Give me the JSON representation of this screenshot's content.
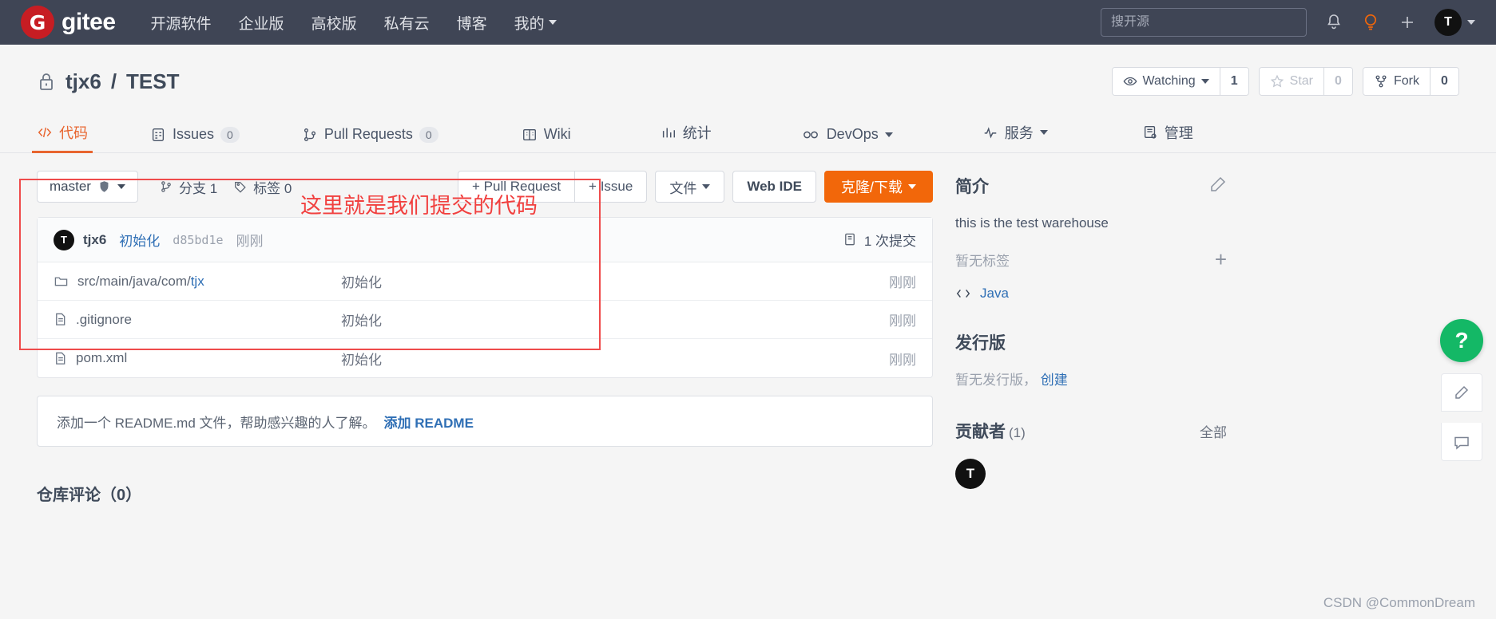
{
  "topnav": {
    "logo_letter": "G",
    "logo_text": "gitee",
    "links": [
      {
        "label": "开源软件",
        "caret": false
      },
      {
        "label": "企业版",
        "caret": false
      },
      {
        "label": "高校版",
        "caret": false
      },
      {
        "label": "私有云",
        "caret": false
      },
      {
        "label": "博客",
        "caret": false
      },
      {
        "label": "我的",
        "caret": true
      }
    ],
    "search_placeholder": "搜开源",
    "avatar_letter": "T",
    "accent_color": "#f2670a",
    "bar_color": "#3f4555"
  },
  "repo": {
    "owner": "tjx6",
    "separator": "/",
    "name": "TEST",
    "watch_label": "Watching",
    "watch_count": "1",
    "star_label": "Star",
    "star_count": "0",
    "fork_label": "Fork",
    "fork_count": "0"
  },
  "tabs": [
    {
      "label": "代码",
      "badge": "",
      "active": true,
      "caret": false
    },
    {
      "label": "Issues",
      "badge": "0",
      "active": false,
      "caret": false
    },
    {
      "label": "Pull Requests",
      "badge": "0",
      "active": false,
      "caret": false
    },
    {
      "label": "Wiki",
      "badge": "",
      "active": false,
      "caret": false
    },
    {
      "label": "统计",
      "badge": "",
      "active": false,
      "caret": false
    },
    {
      "label": "DevOps",
      "badge": "",
      "active": false,
      "caret": true
    },
    {
      "label": "服务",
      "badge": "",
      "active": false,
      "caret": true
    },
    {
      "label": "管理",
      "badge": "",
      "active": false,
      "caret": false
    }
  ],
  "toolbar": {
    "branch": "master",
    "branches_label": "分支 1",
    "tags_label": "标签 0",
    "pull_request_btn": "+ Pull Request",
    "issue_btn": "+ Issue",
    "files_btn": "文件",
    "web_ide_btn": "Web IDE",
    "clone_btn": "克隆/下载"
  },
  "commit": {
    "avatar_letter": "T",
    "author": "tjx6",
    "message": "初始化",
    "hash": "d85bd1e",
    "time": "刚刚",
    "count_label": "1 次提交"
  },
  "annotation": {
    "text": "这里就是我们提交的代码",
    "color": "#f1403f"
  },
  "files": [
    {
      "name": "src/main/java/com/",
      "name_tail": "tjx",
      "type": "folder",
      "message": "初始化",
      "time": "刚刚"
    },
    {
      "name": ".gitignore",
      "name_tail": "",
      "type": "file",
      "message": "初始化",
      "time": "刚刚"
    },
    {
      "name": "pom.xml",
      "name_tail": "",
      "type": "file",
      "message": "初始化",
      "time": "刚刚"
    }
  ],
  "readme_banner": {
    "text": "添加一个 README.md 文件，帮助感兴趣的人了解。",
    "action": "添加 README"
  },
  "comments": {
    "title": "仓库评论（0）"
  },
  "sidebar": {
    "about_title": "简介",
    "description": "this is the test warehouse",
    "no_tags": "暂无标签",
    "language": "Java",
    "releases_title": "发行版",
    "no_releases": "暂无发行版，",
    "create_release": "创建",
    "contributors_title": "贡献者",
    "contributors_count": "(1)",
    "contributors_all": "全部",
    "contributor_avatar": "T"
  },
  "rail": {
    "help_label": "?"
  },
  "watermark": "CSDN @CommonDream"
}
